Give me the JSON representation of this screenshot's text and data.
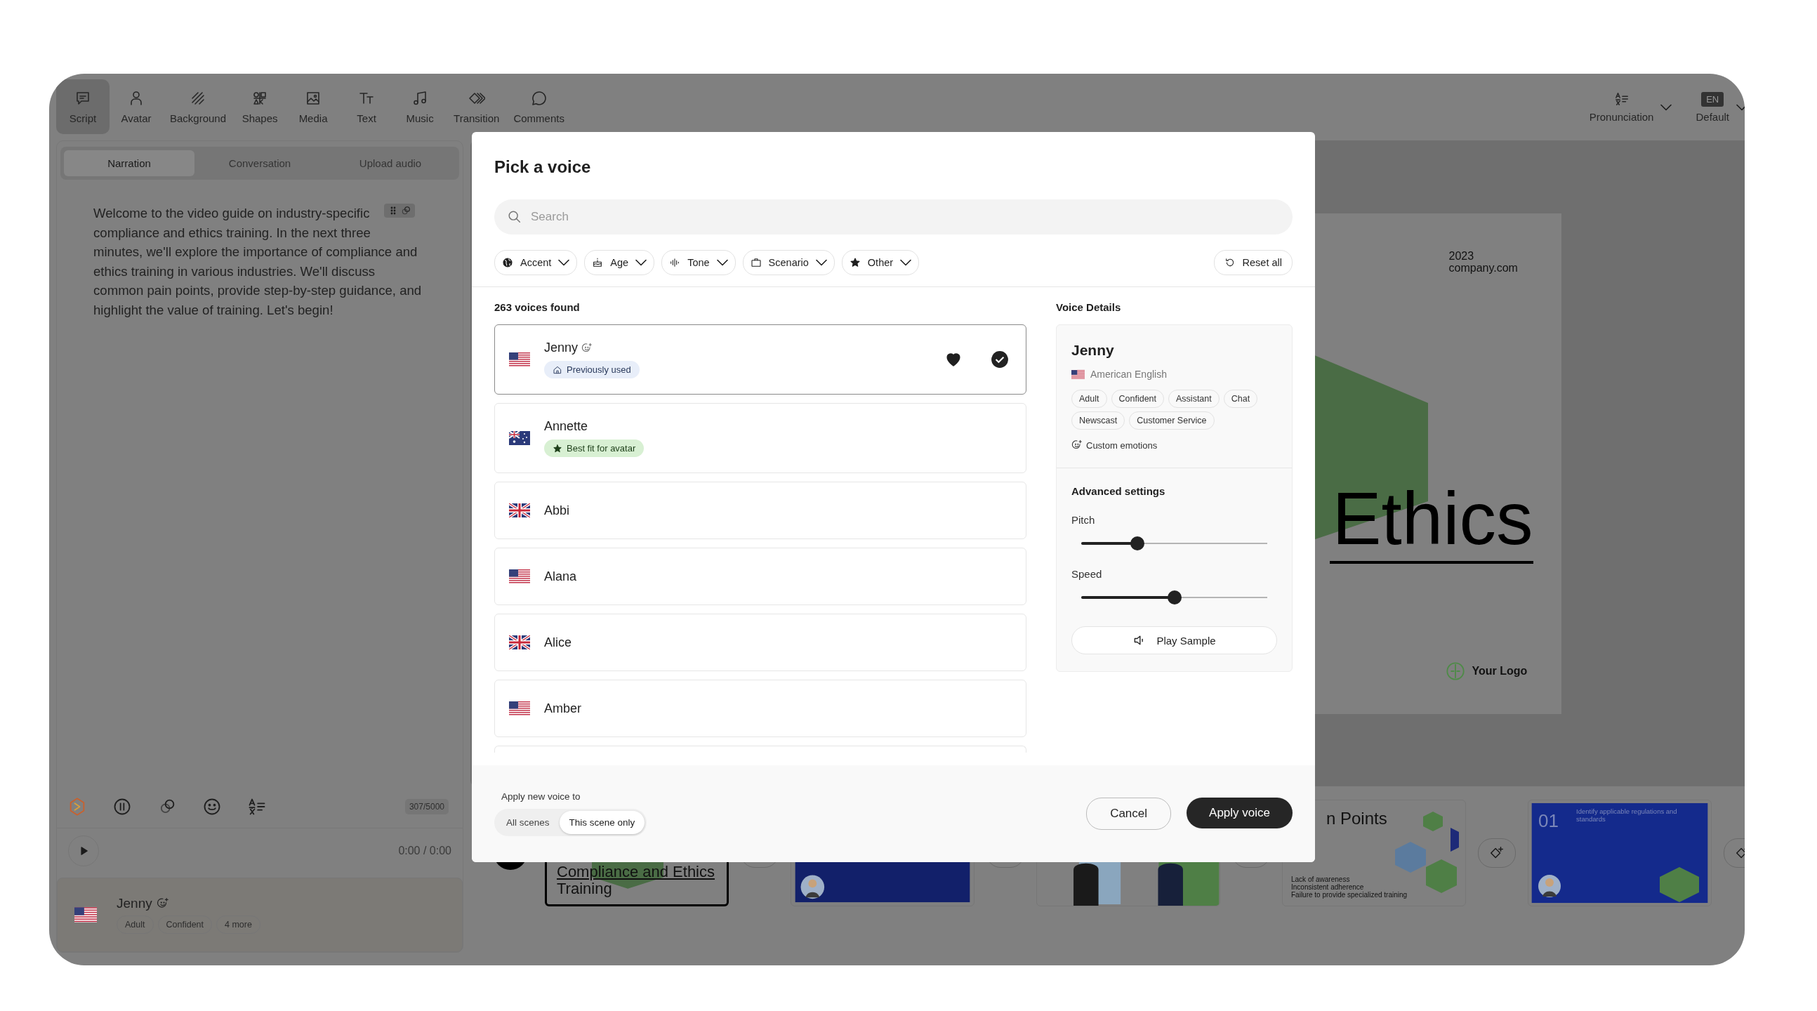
{
  "toolbar": {
    "items": [
      {
        "label": "Script",
        "selected": true
      },
      {
        "label": "Avatar",
        "selected": false
      },
      {
        "label": "Background",
        "selected": false
      },
      {
        "label": "Shapes",
        "selected": false
      },
      {
        "label": "Media",
        "selected": false
      },
      {
        "label": "Text",
        "selected": false
      },
      {
        "label": "Music",
        "selected": false
      },
      {
        "label": "Transition",
        "selected": false
      },
      {
        "label": "Comments",
        "selected": false
      }
    ],
    "pronunciation": "Pronunciation",
    "language": {
      "code": "EN",
      "label": "Default"
    }
  },
  "script_panel": {
    "tabs": [
      {
        "label": "Narration",
        "selected": true
      },
      {
        "label": "Conversation",
        "selected": false
      },
      {
        "label": "Upload audio",
        "selected": false
      }
    ],
    "text": "Welcome to the video guide on industry-specific compliance and ethics training. In the next three minutes, we'll explore the importance of compliance and ethics training in various industries. We'll discuss common pain points, provide step-by-step guidance, and highlight the value of training. Let's begin!",
    "char_count": "307/5000",
    "time": "0:00 / 0:00",
    "voice": {
      "name": "Jenny",
      "flag": {
        "kind": "us"
      },
      "tags": [
        "Adult",
        "Confident",
        "4 more"
      ]
    }
  },
  "slide": {
    "year": "2023",
    "website": "company.com",
    "title": "Ethics",
    "logo": "Your Logo"
  },
  "scenes": [
    {
      "kind": "title",
      "selected": true,
      "lines": [
        "Compliance and Ethics",
        "Training"
      ]
    },
    {
      "kind": "avatar",
      "selected": false
    },
    {
      "kind": "people",
      "selected": false
    },
    {
      "kind": "list",
      "selected": false,
      "title": "n Points",
      "items": [
        "Lack of awareness",
        "Inconsistent adherence",
        "Failure to provide specialized training"
      ]
    },
    {
      "kind": "numbered",
      "selected": false,
      "number": "01",
      "text": "Identify applicable regulations and standards"
    }
  ],
  "dialog": {
    "title": "Pick a voice",
    "search": {
      "placeholder": "Search"
    },
    "filters": [
      "Accent",
      "Age",
      "Tone",
      "Scenario",
      "Other"
    ],
    "reset": "Reset all",
    "count": "263 voices found",
    "voices": [
      {
        "name": "Jenny",
        "flag": {
          "kind": "us"
        },
        "selected": true,
        "favorite": true,
        "emotions": true,
        "badge": {
          "kind": "history",
          "label": "Previously used"
        }
      },
      {
        "name": "Annette",
        "flag": {
          "kind": "au"
        },
        "selected": false,
        "favorite": false,
        "emotions": false,
        "badge": {
          "kind": "recommended",
          "label": "Best fit for avatar"
        }
      },
      {
        "name": "Abbi",
        "flag": {
          "kind": "uk"
        },
        "selected": false,
        "favorite": false,
        "emotions": false
      },
      {
        "name": "Alana",
        "flag": {
          "kind": "us"
        },
        "selected": false,
        "favorite": false,
        "emotions": false
      },
      {
        "name": "Alice",
        "flag": {
          "kind": "uk"
        },
        "selected": false,
        "favorite": false,
        "emotions": false
      },
      {
        "name": "Amber",
        "flag": {
          "kind": "us"
        },
        "selected": false,
        "favorite": false,
        "emotions": false
      }
    ],
    "details": {
      "heading": "Voice Details",
      "name": "Jenny",
      "flag": {
        "kind": "us"
      },
      "language": "American English",
      "tags": [
        "Adult",
        "Confident",
        "Assistant",
        "Chat",
        "Newscast",
        "Customer Service"
      ],
      "emotions": "Custom emotions",
      "advanced": "Advanced settings",
      "sliders": [
        {
          "label": "Pitch",
          "level": 0.3
        },
        {
          "label": "Speed",
          "level": 0.5
        }
      ],
      "play": "Play Sample"
    },
    "apply_to": {
      "label": "Apply new voice to",
      "options": [
        {
          "label": "All scenes",
          "selected": false
        },
        {
          "label": "This scene only",
          "selected": true
        }
      ]
    },
    "cancel": "Cancel",
    "apply": "Apply voice"
  }
}
